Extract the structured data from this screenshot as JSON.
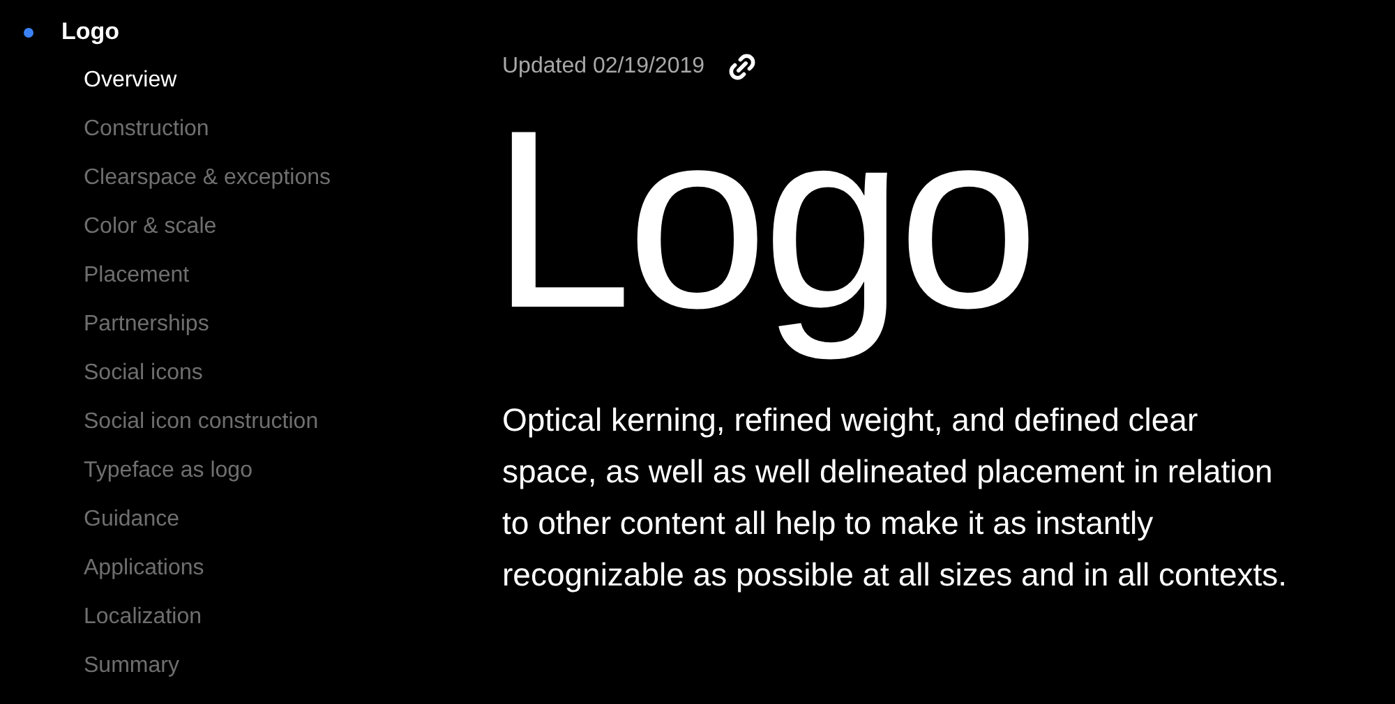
{
  "sidebar": {
    "section": {
      "label": "Logo",
      "selected": true
    },
    "items": [
      {
        "label": "Overview",
        "selected": true
      },
      {
        "label": "Construction",
        "selected": false
      },
      {
        "label": "Clearspace & exceptions",
        "selected": false
      },
      {
        "label": "Color & scale",
        "selected": false
      },
      {
        "label": "Placement",
        "selected": false
      },
      {
        "label": "Partnerships",
        "selected": false
      },
      {
        "label": "Social icons",
        "selected": false
      },
      {
        "label": "Social icon construction",
        "selected": false
      },
      {
        "label": "Typeface as logo",
        "selected": false
      },
      {
        "label": "Guidance",
        "selected": false
      },
      {
        "label": "Applications",
        "selected": false
      },
      {
        "label": "Localization",
        "selected": false
      },
      {
        "label": "Summary",
        "selected": false
      }
    ]
  },
  "main": {
    "updated": "Updated 02/19/2019",
    "title": "Logo",
    "body": "Optical kerning, refined weight, and defined clear space, as well as well delineated placement in relation to other content all help to make it as instantly recognizable as possible at all sizes and in all contexts."
  }
}
